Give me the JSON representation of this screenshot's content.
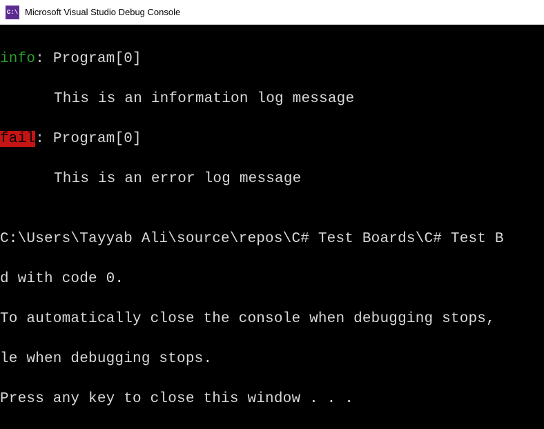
{
  "titlebar": {
    "icon_label": "C:\\",
    "title": "Microsoft Visual Studio Debug Console"
  },
  "log": {
    "info_tag": "info",
    "info_loc": "Program[0]",
    "info_msg": "This is an information log message",
    "fail_tag": "fail",
    "fail_loc": "Program[0]",
    "fail_msg": "This is an error log message"
  },
  "footer": {
    "blank": "",
    "path_line": "C:\\Users\\Tayyab Ali\\source\\repos\\C# Test Boards\\C# Test B",
    "exit_line": "d with code 0.",
    "auto1": "To automatically close the console when debugging stops,",
    "auto2": "le when debugging stops.",
    "press": "Press any key to close this window . . ."
  }
}
